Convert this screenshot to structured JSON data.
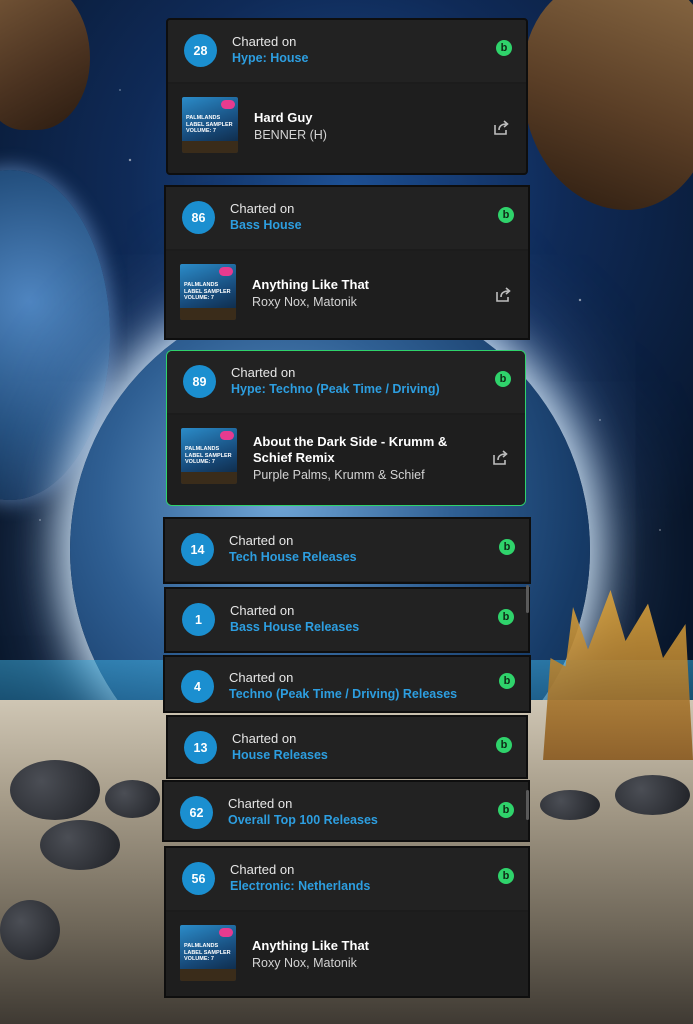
{
  "charted_label": "Charted on",
  "entries": [
    {
      "rank": "28",
      "chart": "Hype: House",
      "track": {
        "title": "Hard Guy",
        "artists": "BENNER (H)"
      }
    },
    {
      "rank": "86",
      "chart": "Bass House",
      "track": {
        "title": "Anything Like That",
        "artists": "Roxy Nox, Matonik"
      }
    },
    {
      "rank": "89",
      "chart": "Hype: Techno (Peak Time / Driving)",
      "highlighted": true,
      "track": {
        "title": "About the Dark Side - Krumm & Schief Remix",
        "artists": "Purple Palms, Krumm & Schief"
      }
    },
    {
      "rank": "14",
      "chart": "Tech House Releases"
    },
    {
      "rank": "1",
      "chart": "Bass House Releases"
    },
    {
      "rank": "4",
      "chart": "Techno (Peak Time / Driving) Releases"
    },
    {
      "rank": "13",
      "chart": "House Releases"
    },
    {
      "rank": "62",
      "chart": "Overall Top 100 Releases"
    },
    {
      "rank": "56",
      "chart": "Electronic: Netherlands",
      "track": {
        "title": "Anything Like That",
        "artists": "Roxy Nox, Matonik"
      }
    }
  ],
  "cover_art_text": "PALMLANDS LABEL SAMPLER VOLUME: 7",
  "colors": {
    "rank_badge": "#1b8fd0",
    "chart_link": "#2d9ee0",
    "beatport_green": "#2fd36b",
    "card_bg": "#1c1c1c"
  },
  "icons": [
    "beatport-icon",
    "share-icon"
  ]
}
